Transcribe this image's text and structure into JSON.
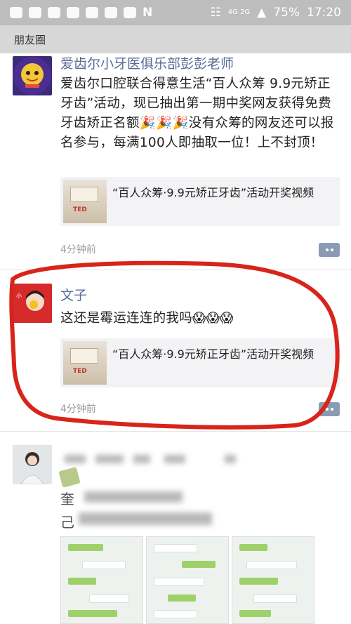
{
  "status_bar": {
    "battery": "75%",
    "time": "17:20",
    "network": "4G 2G"
  },
  "header": {
    "title": "朋友圈"
  },
  "posts": [
    {
      "author": "爱齿尔小牙医俱乐部彭彭老师",
      "text": "爱齿尔口腔联合得意生活“百人众筹 9.9元矫正牙齿”活动，现已抽出第一期中奖网友获得免费牙齿矫正名额🎉🎉🎉没有众筹的网友还可以报名参与，每满100人即抽取一位！上不封顶！",
      "card_title": "“百人众筹·9.9元矫正牙齿”活动开奖视频",
      "card_thumb_label": "TED",
      "time": "4分钟前"
    },
    {
      "author": "文子",
      "text": "这还是霉运连连的我吗😱😱😱",
      "card_title": "“百人众筹·9.9元矫正牙齿”活动开奖视频",
      "card_thumb_label": "TED",
      "time": "4分钟前"
    },
    {
      "text_fragment": "奎",
      "text_fragment2": "己"
    }
  ],
  "colors": {
    "name_link": "#576b95",
    "highlight_loop": "#d8241a"
  }
}
